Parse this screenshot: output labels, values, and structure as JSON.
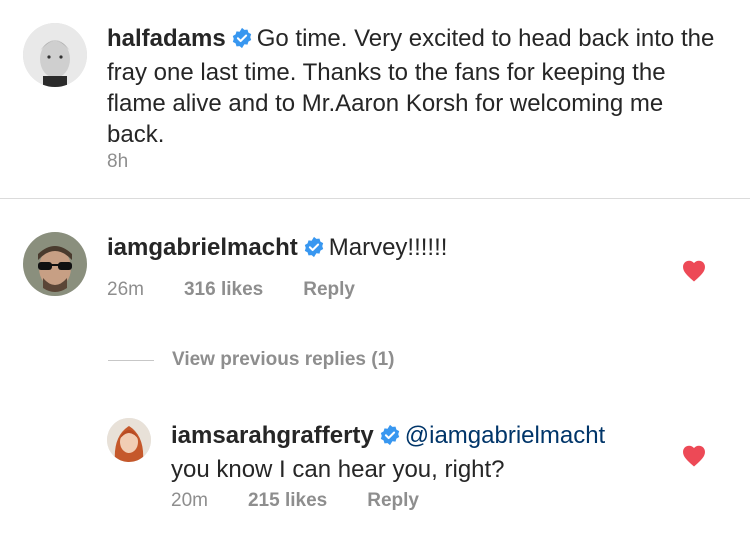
{
  "caption": {
    "username": "halfadams",
    "text": "Go time. Very excited to head back into the fray one last time. Thanks to the fans for keeping the flame alive and to Mr.Aaron Korsh for welcoming me back.",
    "time": "8h"
  },
  "comments": [
    {
      "username": "iamgabrielmacht",
      "text": "Marvey!!!!!!",
      "time": "26m",
      "likes": "316 likes",
      "reply": "Reply"
    }
  ],
  "view_replies": "View previous replies (1)",
  "replies": [
    {
      "username": "iamsarahgrafferty",
      "mention": "@iamgabrielmacht",
      "text": "you know I can hear you, right?",
      "time": "20m",
      "likes": "215 likes",
      "reply": "Reply"
    }
  ],
  "colors": {
    "verified": "#3897f0",
    "heart": "#ed4956",
    "muted": "#8e8e8e",
    "mention": "#003569"
  }
}
